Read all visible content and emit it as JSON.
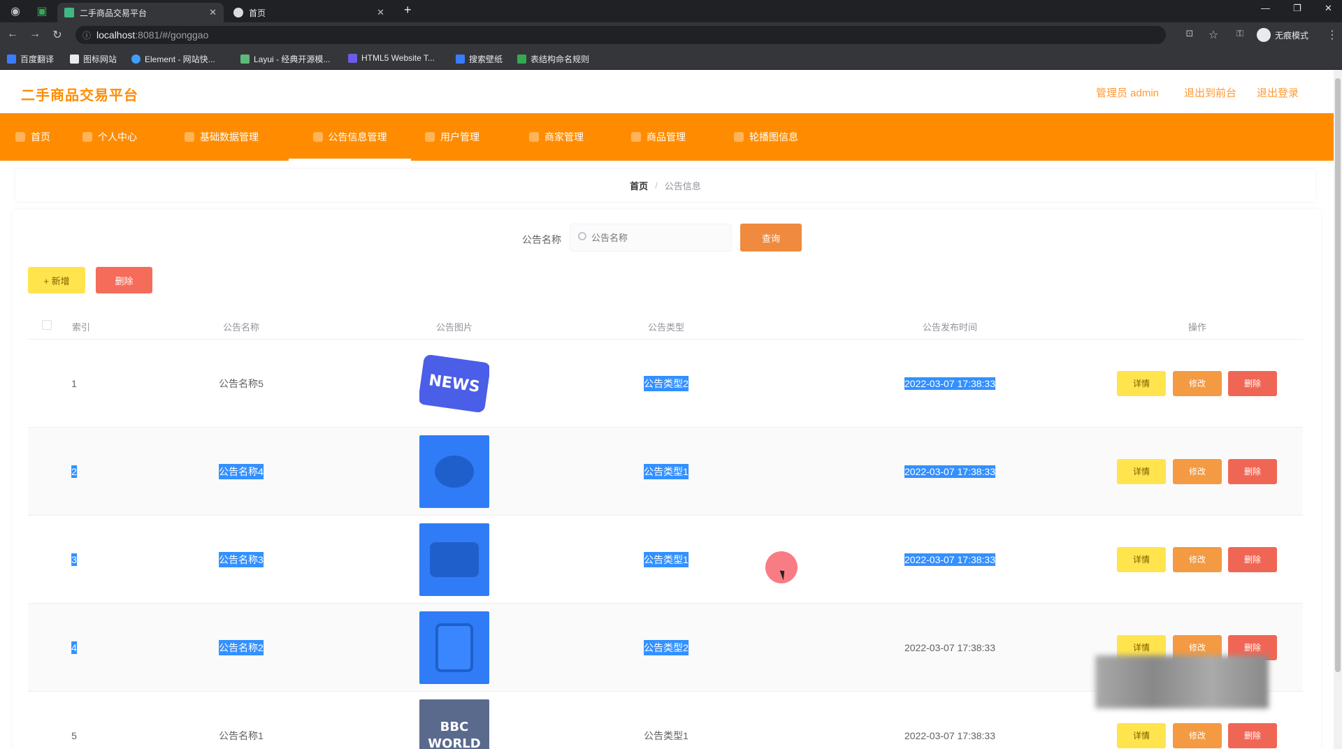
{
  "browser": {
    "tabs": [
      {
        "title": "二手商品交易平台",
        "active": true
      },
      {
        "title": "首页",
        "active": false
      }
    ],
    "new_tab": "+",
    "url_host": "localhost",
    "url_path": ":8081/#/gonggao",
    "incognito_label": "无痕模式",
    "bookmarks": [
      "百度翻译",
      "图标网站",
      "Element - 网站快...",
      "Layui - 经典开源模...",
      "HTML5 Website T...",
      "搜索壁纸",
      "表结构命名规则"
    ],
    "controls": {
      "minimize": "—",
      "restore": "❐",
      "close": "✕"
    }
  },
  "app": {
    "title": "二手商品交易平台",
    "header_links": {
      "admin": "管理员 admin",
      "back": "退出到前台",
      "logout": "退出登录"
    },
    "menu": [
      "首页",
      "个人中心",
      "基础数据管理",
      "公告信息管理",
      "用户管理",
      "商家管理",
      "商品管理",
      "轮播图信息"
    ],
    "active_menu": "公告信息管理"
  },
  "breadcrumb": {
    "home": "首页",
    "separator": "/",
    "current": "公告信息"
  },
  "search": {
    "label": "公告名称",
    "placeholder": "公告名称",
    "query_button": "查询"
  },
  "toolbar": {
    "add_label": "+ 新增",
    "delete_label": "删除"
  },
  "table": {
    "columns": [
      "索引",
      "公告名称",
      "公告图片",
      "公告类型",
      "公告发布时间",
      "操作"
    ],
    "rows": [
      {
        "index": "1",
        "name": "公告名称5",
        "type": "公告类型2",
        "time": "2022-03-07 17:38:33",
        "image": "NEWS"
      },
      {
        "index": "2",
        "name": "公告名称4",
        "type": "公告类型1",
        "time": "2022-03-07 17:38:33",
        "image": ""
      },
      {
        "index": "3",
        "name": "公告名称3",
        "type": "公告类型1",
        "time": "2022-03-07 17:38:33",
        "image": ""
      },
      {
        "index": "4",
        "name": "公告名称2",
        "type": "公告类型2",
        "time": "2022-03-07 17:38:33",
        "image": ""
      },
      {
        "index": "5",
        "name": "公告名称1",
        "type": "公告类型1",
        "time": "2022-03-07 17:38:33",
        "image": "BBC WORLD"
      }
    ],
    "actions": {
      "detail": "详情",
      "edit": "修改",
      "delete": "删除"
    }
  },
  "colors": {
    "primary": "#ff8c00",
    "selection": "#3390ff",
    "detail": "#ffe44d",
    "edit": "#f39a42",
    "delete": "#f06654"
  }
}
